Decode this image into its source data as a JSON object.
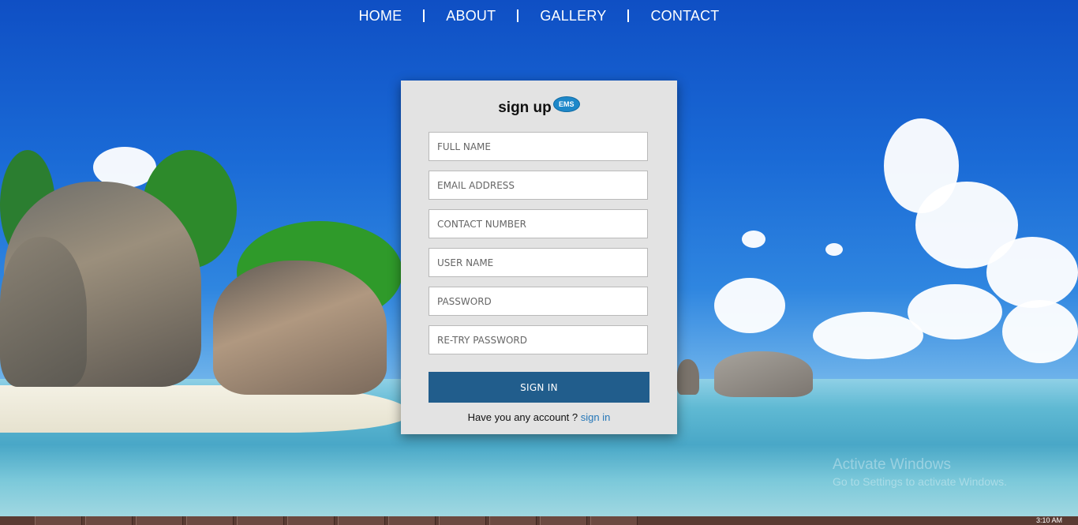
{
  "nav": {
    "items": [
      "HOME",
      "ABOUT",
      "GALLERY",
      "CONTACT"
    ]
  },
  "form": {
    "title": "sign up",
    "badge": "EMS",
    "fields": {
      "full_name": "FULL NAME",
      "email": "EMAIL ADDRESS",
      "contact": "CONTACT NUMBER",
      "username": "USER NAME",
      "password": "PASSWORD",
      "retry_password": "RE-TRY PASSWORD"
    },
    "submit_label": "SIGN IN",
    "account_prompt": "Have you any account ?",
    "signin_link": "sign in"
  },
  "watermark": {
    "line1": "Activate Windows",
    "line2": "Go to Settings to activate Windows."
  },
  "taskbar": {
    "clock": "3:10 AM"
  },
  "colors": {
    "button": "#215d8c",
    "link": "#2577b8",
    "card": "#e3e3e3"
  }
}
